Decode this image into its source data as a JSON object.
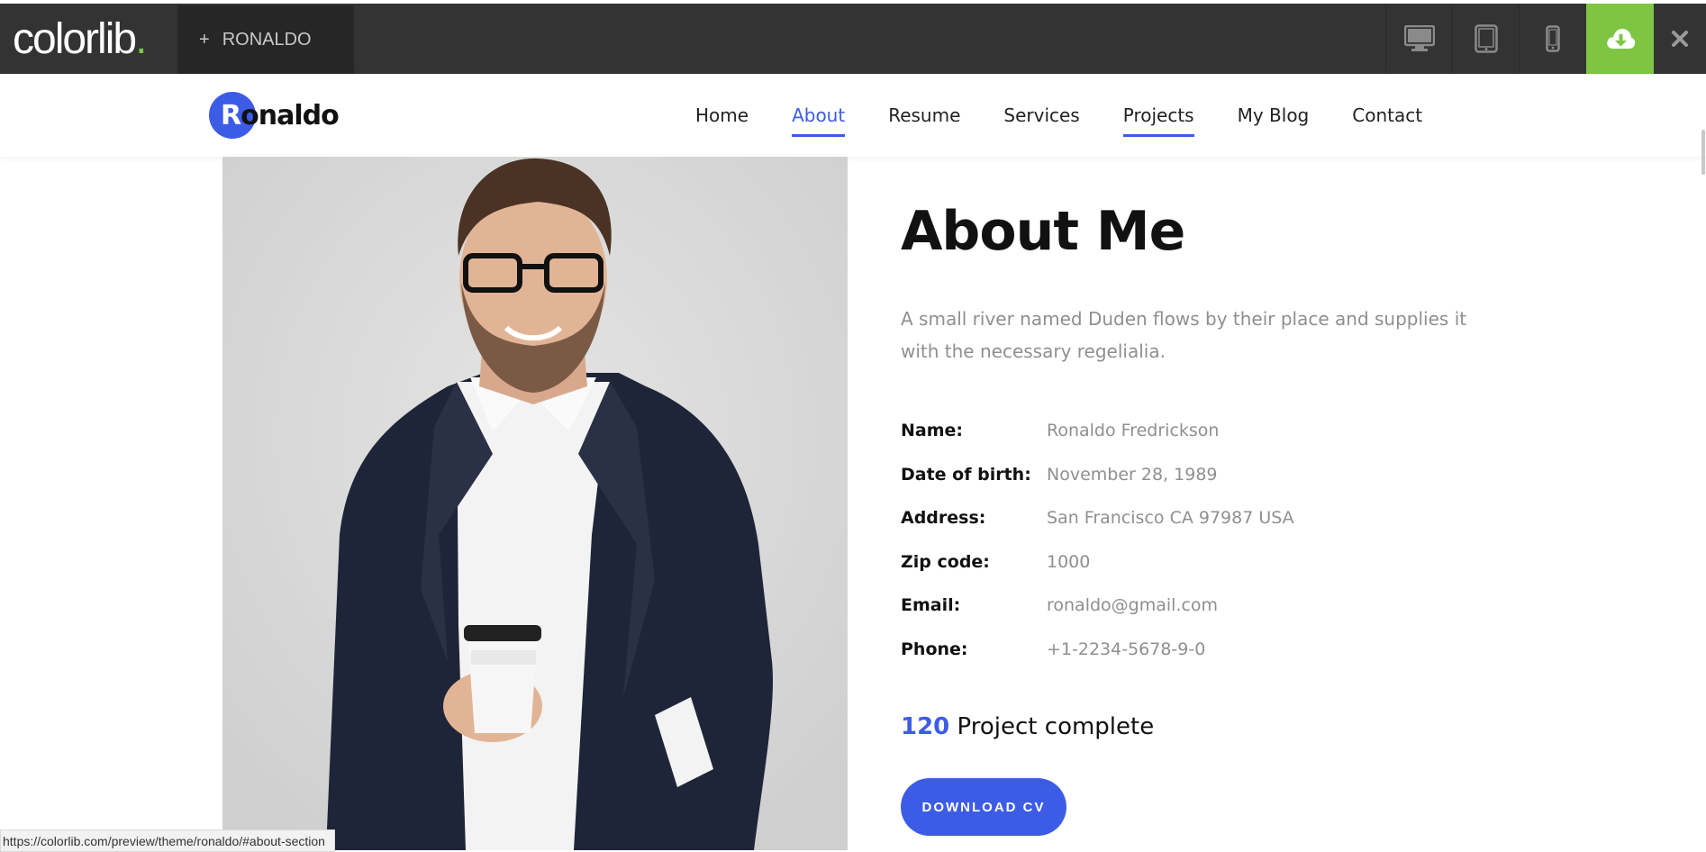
{
  "topbar": {
    "brand_name": "colorlib",
    "brand_dot": ".",
    "theme_tab_plus": "+",
    "theme_tab_label": "RONALDO",
    "device_icons": [
      "desktop-icon",
      "tablet-icon",
      "mobile-icon"
    ],
    "download_icon": "cloud-download-icon",
    "close_label": "✕",
    "accent_color": "#7ec544"
  },
  "site": {
    "logo_first": "R",
    "logo_rest": "onaldo",
    "nav": [
      {
        "label": "Home"
      },
      {
        "label": "About"
      },
      {
        "label": "Resume"
      },
      {
        "label": "Services"
      },
      {
        "label": "Projects"
      },
      {
        "label": "My Blog"
      },
      {
        "label": "Contact"
      }
    ],
    "accent_color": "#3d5ce6"
  },
  "about": {
    "title": "About Me",
    "description": "A small river named Duden flows by their place and supplies it with the necessary regelialia.",
    "info": [
      {
        "label": "Name:",
        "value": "Ronaldo Fredrickson"
      },
      {
        "label": "Date of birth:",
        "value": "November 28, 1989"
      },
      {
        "label": "Address:",
        "value": "San Francisco CA 97987 USA"
      },
      {
        "label": "Zip code:",
        "value": "1000"
      },
      {
        "label": "Email:",
        "value": "ronaldo@gmail.com"
      },
      {
        "label": "Phone:",
        "value": "+1-2234-5678-9-0"
      }
    ],
    "projects_count": "120",
    "projects_label": "Project complete",
    "cv_button": "DOWNLOAD CV"
  },
  "status_url": "https://colorlib.com/preview/theme/ronaldo/#about-section"
}
